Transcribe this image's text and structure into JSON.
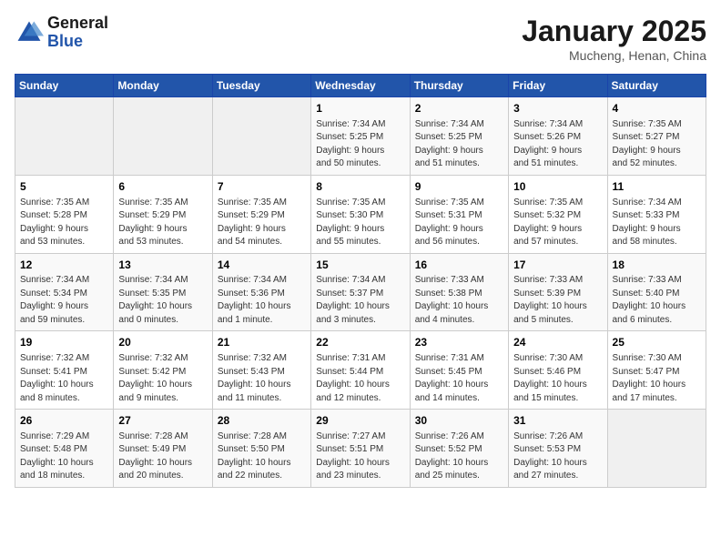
{
  "logo": {
    "line1": "General",
    "line2": "Blue"
  },
  "title": "January 2025",
  "location": "Mucheng, Henan, China",
  "days_of_week": [
    "Sunday",
    "Monday",
    "Tuesday",
    "Wednesday",
    "Thursday",
    "Friday",
    "Saturday"
  ],
  "weeks": [
    [
      {
        "day": "",
        "info": ""
      },
      {
        "day": "",
        "info": ""
      },
      {
        "day": "",
        "info": ""
      },
      {
        "day": "1",
        "info": "Sunrise: 7:34 AM\nSunset: 5:25 PM\nDaylight: 9 hours\nand 50 minutes."
      },
      {
        "day": "2",
        "info": "Sunrise: 7:34 AM\nSunset: 5:25 PM\nDaylight: 9 hours\nand 51 minutes."
      },
      {
        "day": "3",
        "info": "Sunrise: 7:34 AM\nSunset: 5:26 PM\nDaylight: 9 hours\nand 51 minutes."
      },
      {
        "day": "4",
        "info": "Sunrise: 7:35 AM\nSunset: 5:27 PM\nDaylight: 9 hours\nand 52 minutes."
      }
    ],
    [
      {
        "day": "5",
        "info": "Sunrise: 7:35 AM\nSunset: 5:28 PM\nDaylight: 9 hours\nand 53 minutes."
      },
      {
        "day": "6",
        "info": "Sunrise: 7:35 AM\nSunset: 5:29 PM\nDaylight: 9 hours\nand 53 minutes."
      },
      {
        "day": "7",
        "info": "Sunrise: 7:35 AM\nSunset: 5:29 PM\nDaylight: 9 hours\nand 54 minutes."
      },
      {
        "day": "8",
        "info": "Sunrise: 7:35 AM\nSunset: 5:30 PM\nDaylight: 9 hours\nand 55 minutes."
      },
      {
        "day": "9",
        "info": "Sunrise: 7:35 AM\nSunset: 5:31 PM\nDaylight: 9 hours\nand 56 minutes."
      },
      {
        "day": "10",
        "info": "Sunrise: 7:35 AM\nSunset: 5:32 PM\nDaylight: 9 hours\nand 57 minutes."
      },
      {
        "day": "11",
        "info": "Sunrise: 7:34 AM\nSunset: 5:33 PM\nDaylight: 9 hours\nand 58 minutes."
      }
    ],
    [
      {
        "day": "12",
        "info": "Sunrise: 7:34 AM\nSunset: 5:34 PM\nDaylight: 9 hours\nand 59 minutes."
      },
      {
        "day": "13",
        "info": "Sunrise: 7:34 AM\nSunset: 5:35 PM\nDaylight: 10 hours\nand 0 minutes."
      },
      {
        "day": "14",
        "info": "Sunrise: 7:34 AM\nSunset: 5:36 PM\nDaylight: 10 hours\nand 1 minute."
      },
      {
        "day": "15",
        "info": "Sunrise: 7:34 AM\nSunset: 5:37 PM\nDaylight: 10 hours\nand 3 minutes."
      },
      {
        "day": "16",
        "info": "Sunrise: 7:33 AM\nSunset: 5:38 PM\nDaylight: 10 hours\nand 4 minutes."
      },
      {
        "day": "17",
        "info": "Sunrise: 7:33 AM\nSunset: 5:39 PM\nDaylight: 10 hours\nand 5 minutes."
      },
      {
        "day": "18",
        "info": "Sunrise: 7:33 AM\nSunset: 5:40 PM\nDaylight: 10 hours\nand 6 minutes."
      }
    ],
    [
      {
        "day": "19",
        "info": "Sunrise: 7:32 AM\nSunset: 5:41 PM\nDaylight: 10 hours\nand 8 minutes."
      },
      {
        "day": "20",
        "info": "Sunrise: 7:32 AM\nSunset: 5:42 PM\nDaylight: 10 hours\nand 9 minutes."
      },
      {
        "day": "21",
        "info": "Sunrise: 7:32 AM\nSunset: 5:43 PM\nDaylight: 10 hours\nand 11 minutes."
      },
      {
        "day": "22",
        "info": "Sunrise: 7:31 AM\nSunset: 5:44 PM\nDaylight: 10 hours\nand 12 minutes."
      },
      {
        "day": "23",
        "info": "Sunrise: 7:31 AM\nSunset: 5:45 PM\nDaylight: 10 hours\nand 14 minutes."
      },
      {
        "day": "24",
        "info": "Sunrise: 7:30 AM\nSunset: 5:46 PM\nDaylight: 10 hours\nand 15 minutes."
      },
      {
        "day": "25",
        "info": "Sunrise: 7:30 AM\nSunset: 5:47 PM\nDaylight: 10 hours\nand 17 minutes."
      }
    ],
    [
      {
        "day": "26",
        "info": "Sunrise: 7:29 AM\nSunset: 5:48 PM\nDaylight: 10 hours\nand 18 minutes."
      },
      {
        "day": "27",
        "info": "Sunrise: 7:28 AM\nSunset: 5:49 PM\nDaylight: 10 hours\nand 20 minutes."
      },
      {
        "day": "28",
        "info": "Sunrise: 7:28 AM\nSunset: 5:50 PM\nDaylight: 10 hours\nand 22 minutes."
      },
      {
        "day": "29",
        "info": "Sunrise: 7:27 AM\nSunset: 5:51 PM\nDaylight: 10 hours\nand 23 minutes."
      },
      {
        "day": "30",
        "info": "Sunrise: 7:26 AM\nSunset: 5:52 PM\nDaylight: 10 hours\nand 25 minutes."
      },
      {
        "day": "31",
        "info": "Sunrise: 7:26 AM\nSunset: 5:53 PM\nDaylight: 10 hours\nand 27 minutes."
      },
      {
        "day": "",
        "info": ""
      }
    ]
  ]
}
